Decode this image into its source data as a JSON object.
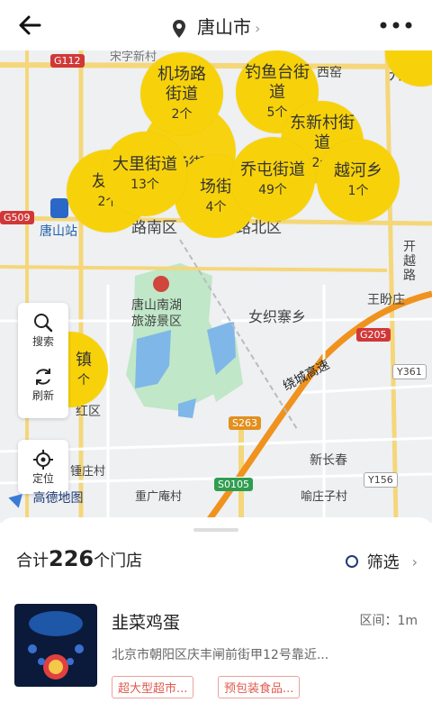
{
  "header": {
    "city": "唐山市",
    "chevron": "›"
  },
  "map": {
    "labels": {
      "kaiping": "开平",
      "tangshan_station": "唐山站",
      "lunan": "路南区",
      "lubei": "路北区",
      "nanhu": "唐山南湖\n旅游景区",
      "nvzhi": "女织寨乡",
      "jingcheng": "绕城高速",
      "kaiyue": "开越路",
      "wangpan": "王盼庄",
      "xinchangchun": "新长春",
      "chongguang": "重广庵村",
      "yuzhuang": "喻庄子村",
      "guzhuang": "锺庄村",
      "song": "宋字新村",
      "xiyao": "西窑",
      "ezhuang": "红区"
    },
    "roads": {
      "g112": "G112",
      "g509": "G509",
      "g205": "G205",
      "y361": "Y361",
      "s263": "S263",
      "s0105": "S0105",
      "y156": "Y156"
    },
    "bubbles": [
      {
        "name": "机场路街道",
        "count": "2个"
      },
      {
        "name": "钓鱼台街道",
        "count": "5个"
      },
      {
        "name": "东新村街道",
        "count": "2个"
      },
      {
        "name": "大里街道",
        "count": "13个"
      },
      {
        "name": "友谊",
        "count": "2个"
      },
      {
        "name": "乔屯街道",
        "count": "49个"
      },
      {
        "name": "越河乡",
        "count": "1个"
      },
      {
        "name": "场街",
        "count": "4个"
      },
      {
        "name": "镇",
        "count": "个"
      }
    ],
    "controls": {
      "search": "搜索",
      "refresh": "刷新",
      "locate": "定位"
    },
    "logo": "高德地图"
  },
  "summary": {
    "prefix": "合计",
    "count": "226",
    "suffix": "个门店",
    "filter": "筛选",
    "chevron": "›"
  },
  "store": {
    "name": "韭菜鸡蛋",
    "distance": "区间：1m",
    "address": "北京市朝阳区庆丰闸前街甲12号靠近...",
    "tags": [
      "超大型超市...",
      "预包装食品..."
    ]
  },
  "colors": {
    "bubble": "#f7d20a",
    "accent": "#1f3b77",
    "tag": "#e05a4f"
  }
}
